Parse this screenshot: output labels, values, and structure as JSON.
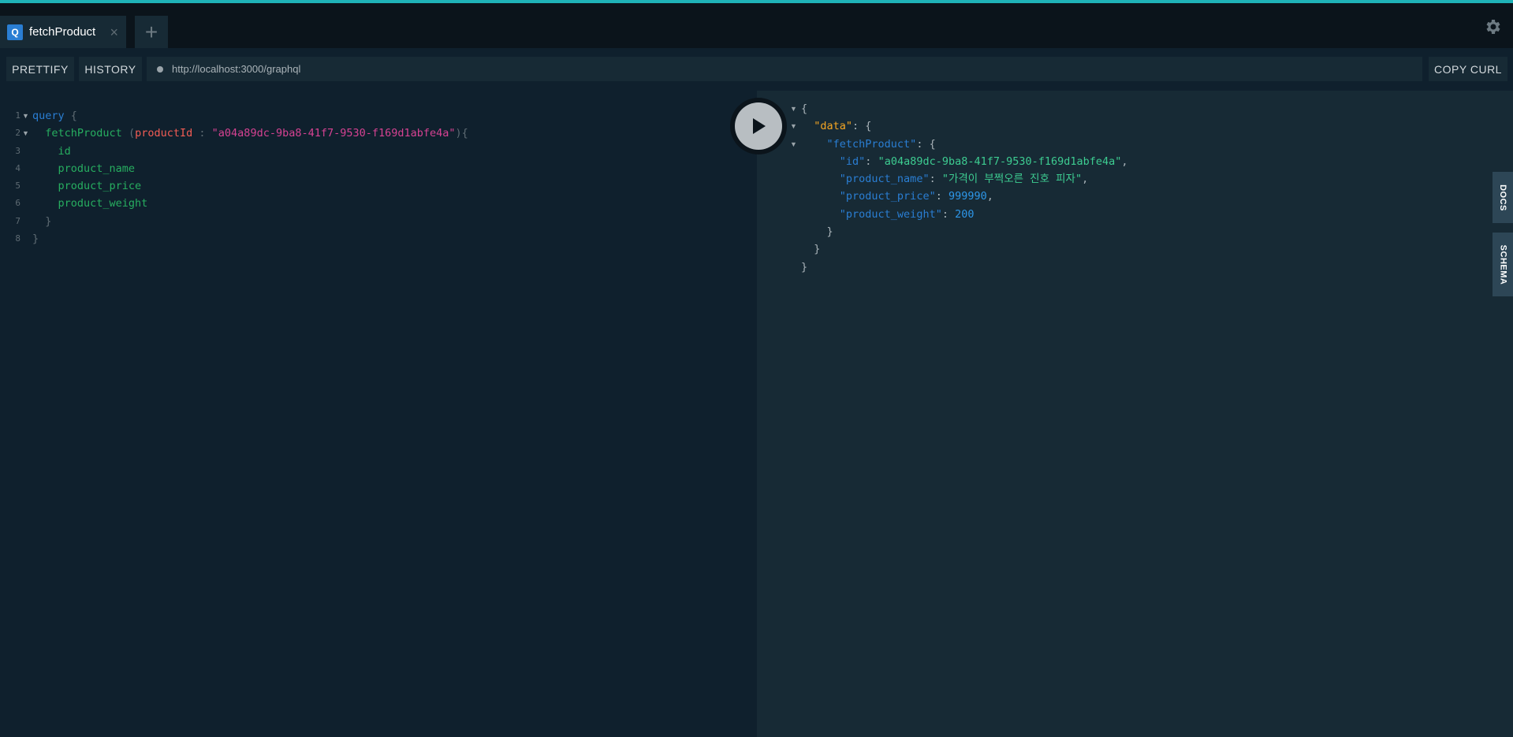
{
  "tabs": [
    {
      "badge": "Q",
      "title": "fetchProduct",
      "close": "×"
    }
  ],
  "add_tab": "+",
  "toolbar": {
    "prettify": "PRETTIFY",
    "history": "HISTORY",
    "url": "http://localhost:3000/graphql",
    "copy_curl": "COPY CURL"
  },
  "side_tabs": {
    "docs": "DOCS",
    "schema": "SCHEMA"
  },
  "editor": {
    "line_numbers": [
      "1",
      "2",
      "3",
      "4",
      "5",
      "6",
      "7",
      "8"
    ],
    "query_keyword": "query",
    "field": "fetchProduct",
    "arg_name": "productId",
    "arg_value": "\"a04a89dc-9ba8-41f7-9530-f169d1abfe4a\"",
    "selections": [
      "id",
      "product_name",
      "product_price",
      "product_weight"
    ]
  },
  "result": {
    "data_key": "\"data\"",
    "fetch_key": "\"fetchProduct\"",
    "rows": [
      {
        "key": "\"id\"",
        "value": "\"a04a89dc-9ba8-41f7-9530-f169d1abfe4a\"",
        "kind": "string",
        "comma": ","
      },
      {
        "key": "\"product_name\"",
        "value": "\"가격이 부쩍오른 진호 피자\"",
        "kind": "string",
        "comma": ","
      },
      {
        "key": "\"product_price\"",
        "value": "999990",
        "kind": "number",
        "comma": ","
      },
      {
        "key": "\"product_weight\"",
        "value": "200",
        "kind": "number",
        "comma": ""
      }
    ]
  },
  "colors": {
    "accent": "#1fb3b8",
    "keyword": "#2a7ed3",
    "field": "#27ae60",
    "argument": "#f25c54",
    "string": "#d64292",
    "json_key": "#2a7ed3",
    "json_string": "#3dcc91",
    "json_number": "#2d96e8"
  }
}
